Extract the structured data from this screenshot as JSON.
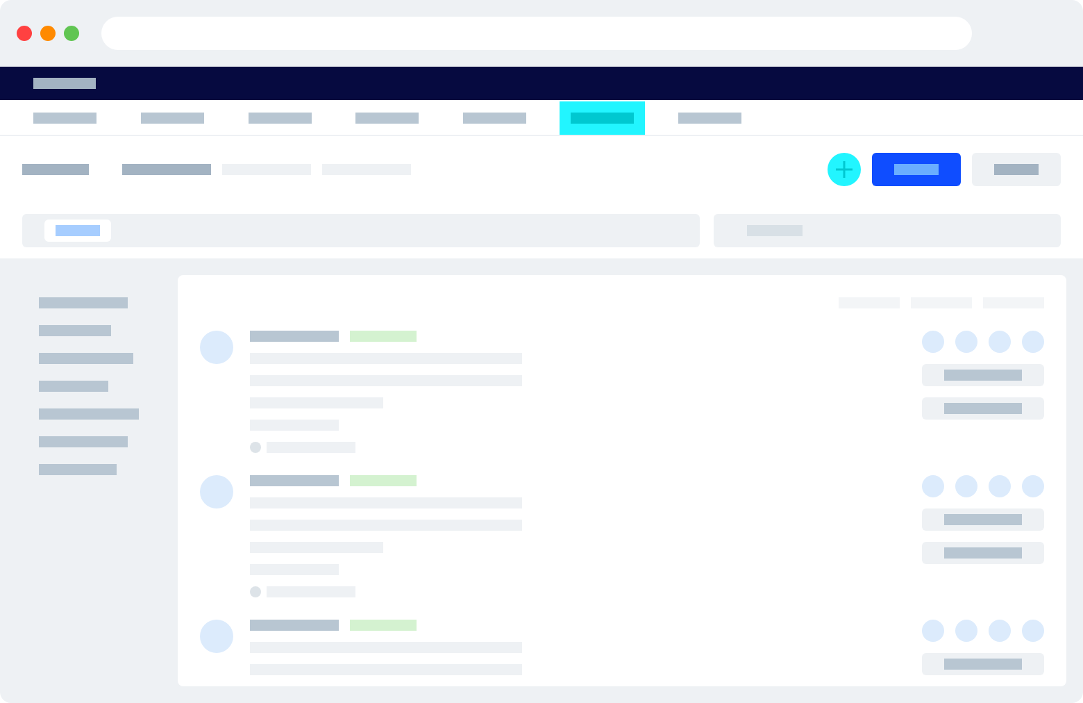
{
  "window": {
    "controls": [
      {
        "kind": "close"
      },
      {
        "kind": "minimize"
      },
      {
        "kind": "maximize"
      }
    ]
  },
  "tabs": [
    {
      "selected": false
    },
    {
      "selected": false
    },
    {
      "selected": false
    },
    {
      "selected": false
    },
    {
      "selected": false
    },
    {
      "selected": true
    },
    {
      "selected": false
    }
  ]
}
